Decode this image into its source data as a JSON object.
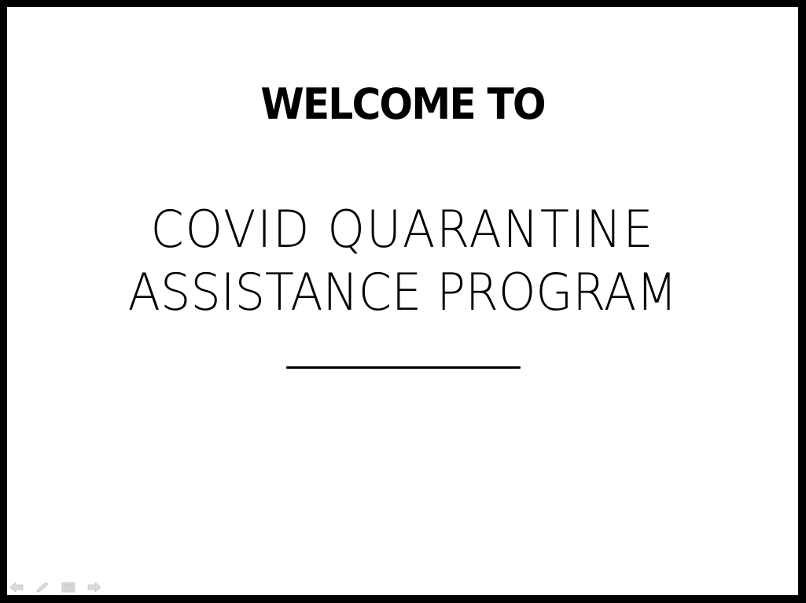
{
  "slide": {
    "heading": "WELCOME TO",
    "title_lines": [
      "COVID QUARANTINE",
      "ASSISTANCE PROGRAM"
    ]
  },
  "controls": {
    "icons": [
      "previous-arrow-icon",
      "pen-icon",
      "menu-icon",
      "next-arrow-icon"
    ]
  },
  "colors": {
    "frame": "#000000",
    "slide_background": "#ffffff",
    "text": "#000000",
    "controls": "#9a9a9a"
  }
}
